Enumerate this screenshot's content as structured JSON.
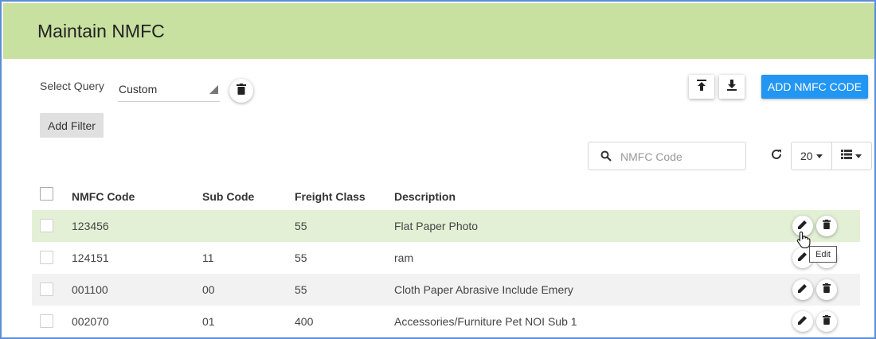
{
  "page": {
    "title": "Maintain NMFC"
  },
  "query": {
    "label": "Select Query",
    "selected": "Custom"
  },
  "buttons": {
    "add_filter": "Add Filter",
    "add_code": "ADD NMFC CODE"
  },
  "search": {
    "placeholder": "NMFC Code",
    "value": ""
  },
  "pagination": {
    "page_size": "20"
  },
  "table": {
    "headers": {
      "code": "NMFC Code",
      "sub": "Sub Code",
      "freight": "Freight Class",
      "desc": "Description"
    },
    "rows": [
      {
        "code": "123456",
        "sub": "",
        "freight": "55",
        "desc": "Flat Paper Photo"
      },
      {
        "code": "124151",
        "sub": "11",
        "freight": "55",
        "desc": "ram"
      },
      {
        "code": "001100",
        "sub": "00",
        "freight": "55",
        "desc": "Cloth Paper Abrasive Include Emery"
      },
      {
        "code": "002070",
        "sub": "01",
        "freight": "400",
        "desc": "Accessories/Furniture Pet NOI Sub 1"
      }
    ]
  },
  "tooltip": {
    "text": "Edit"
  },
  "colors": {
    "header_bg": "#c8e0a0",
    "accent": "#2196f3",
    "row_hover": "#e4f0d6",
    "row_alt": "#f2f2f2",
    "frame": "#5a8fd6"
  },
  "icons": {
    "query_delete": "trash-icon",
    "import": "upload-icon",
    "export": "download-icon",
    "search": "search-icon",
    "refresh": "refresh-icon",
    "columns": "list-columns-icon",
    "row_edit": "pencil-icon",
    "row_delete": "trash-icon"
  }
}
